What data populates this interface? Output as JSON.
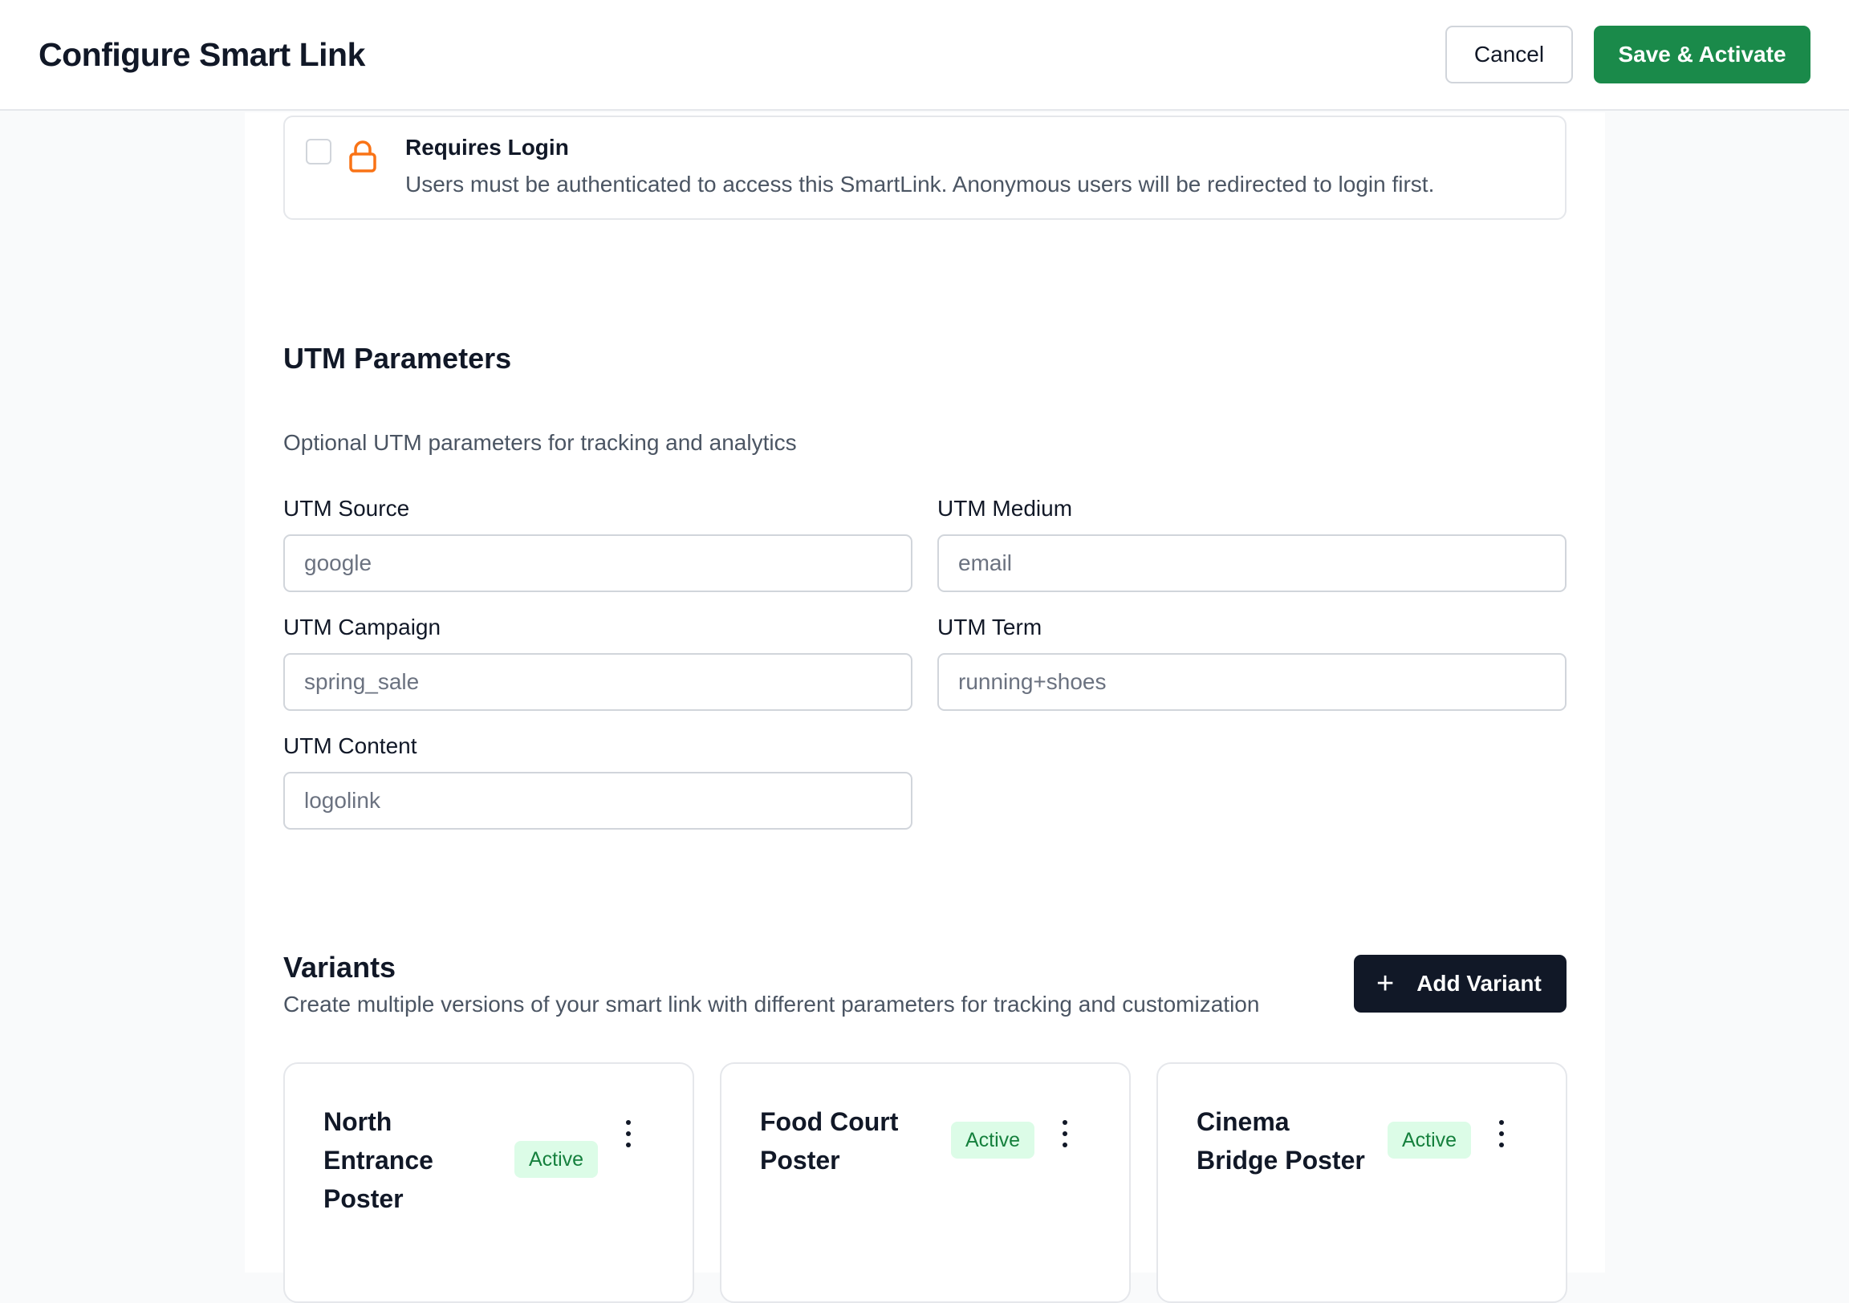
{
  "header": {
    "title": "Configure Smart Link",
    "cancel_label": "Cancel",
    "save_label": "Save & Activate"
  },
  "login_option": {
    "title": "Requires Login",
    "description": "Users must be authenticated to access this SmartLink. Anonymous users will be redirected to login first.",
    "checked": false,
    "icon": "lock-icon",
    "icon_color": "#f97316"
  },
  "utm": {
    "heading": "UTM Parameters",
    "subtitle": "Optional UTM parameters for tracking and analytics",
    "fields": [
      {
        "label": "UTM Source",
        "placeholder": "google",
        "value": ""
      },
      {
        "label": "UTM Medium",
        "placeholder": "email",
        "value": ""
      },
      {
        "label": "UTM Campaign",
        "placeholder": "spring_sale",
        "value": ""
      },
      {
        "label": "UTM Term",
        "placeholder": "running+shoes",
        "value": ""
      },
      {
        "label": "UTM Content",
        "placeholder": "logolink",
        "value": ""
      }
    ]
  },
  "variants": {
    "heading": "Variants",
    "subtitle": "Create multiple versions of your smart link with different parameters for tracking and customization",
    "add_label": "Add Variant",
    "items": [
      {
        "name": "North Entrance Poster",
        "status": "Active"
      },
      {
        "name": "Food Court Poster",
        "status": "Active"
      },
      {
        "name": "Cinema Bridge Poster",
        "status": "Active"
      }
    ]
  },
  "colors": {
    "primary_green": "#1a8a4a",
    "dark_button": "#111827",
    "badge_bg": "#dcfce7",
    "badge_text": "#15803d"
  }
}
